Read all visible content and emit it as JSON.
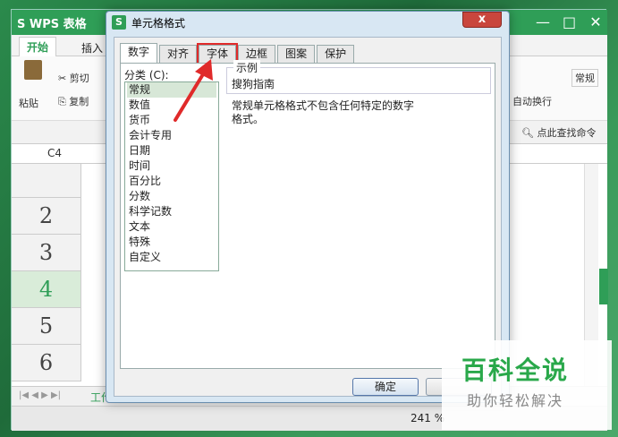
{
  "app": {
    "title": "WPS 表格",
    "ribbon_tabs": [
      "开始",
      "插入"
    ],
    "ribbon": {
      "cut": "剪切",
      "copy": "复制",
      "paste": "粘贴",
      "wrap_text": "自动换行",
      "normal": "常规",
      "find": "点此查找命令"
    },
    "name_box": "C4",
    "rows": [
      "2",
      "3",
      "4",
      "5",
      "6"
    ],
    "active_row": "4",
    "sheet_tab": "工作",
    "zoom": "241 %"
  },
  "dialog": {
    "title": "单元格格式",
    "close_label": "x",
    "tabs": [
      {
        "label": "数字",
        "active": true
      },
      {
        "label": "对齐",
        "active": false
      },
      {
        "label": "字体",
        "active": false,
        "highlighted": true
      },
      {
        "label": "边框",
        "active": false
      },
      {
        "label": "图案",
        "active": false
      },
      {
        "label": "保护",
        "active": false
      }
    ],
    "category_label": "分类 (C):",
    "categories": [
      "常规",
      "数值",
      "货币",
      "会计专用",
      "日期",
      "时间",
      "百分比",
      "分数",
      "科学记数",
      "文本",
      "特殊",
      "自定义"
    ],
    "selected_category": "常规",
    "sample_label": "示例",
    "sample_value": "搜狗指南",
    "description": "常规单元格格式不包含任何特定的数字格式。",
    "ok_label": "确定"
  },
  "watermark": {
    "title": "百科全说",
    "subtitle": "助你轻松解决"
  },
  "colors": {
    "accent_green": "#2f9e57",
    "highlight_red": "#e02a2a",
    "close_red": "#c9463d"
  }
}
